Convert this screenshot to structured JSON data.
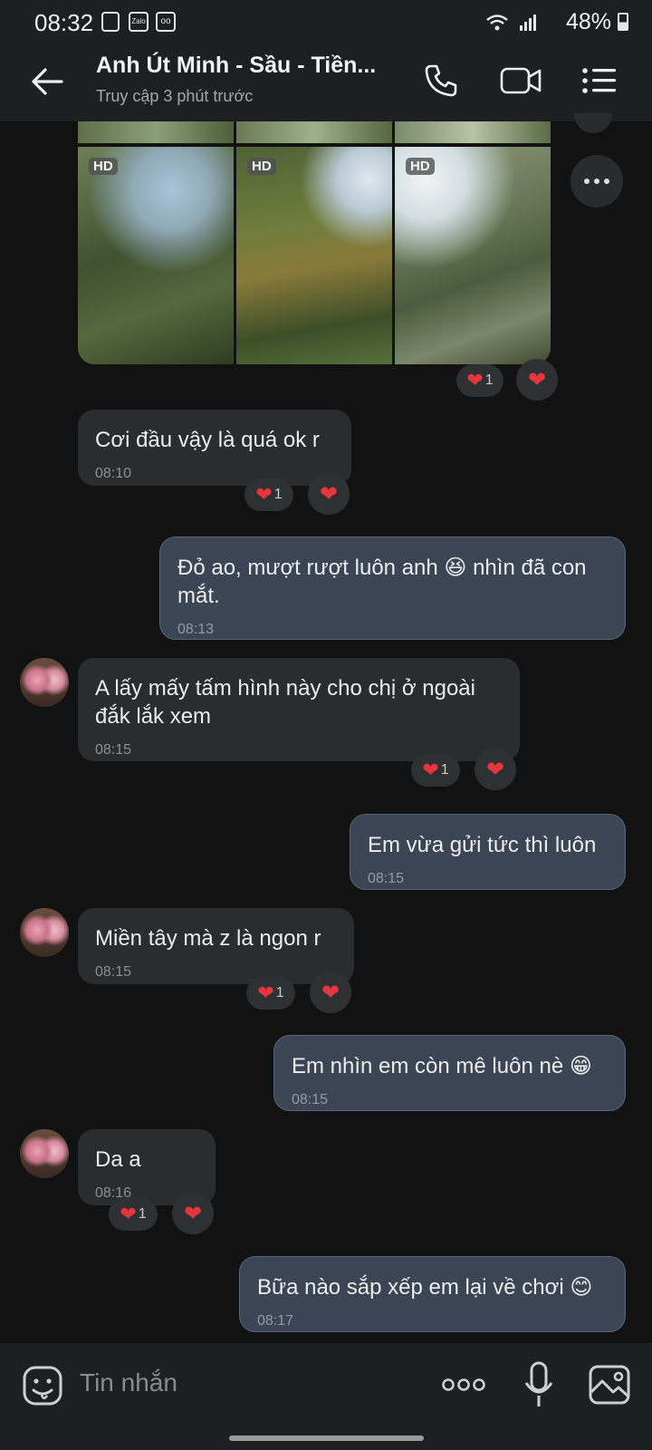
{
  "status": {
    "time": "08:32",
    "zalo": "Zalo",
    "battery": "48%"
  },
  "header": {
    "title": "Anh Út Minh - Sầu - Tiền...",
    "subtitle": "Truy cập 3 phút trước"
  },
  "photos": {
    "badge": "HD"
  },
  "messages": [
    {
      "text": "Cơi đầu vậy là quá ok r",
      "time": "08:10",
      "count": "1"
    },
    {
      "text": "Đỏ ao, mượt rượt luôn anh 😆 nhìn đã con mắt.",
      "time": "08:13"
    },
    {
      "text": "A lấy mấy tấm hình này cho chị ở ngoài đắk lắk xem",
      "time": "08:15",
      "count": "1"
    },
    {
      "text": "Em vừa gửi tức thì luôn",
      "time": "08:15"
    },
    {
      "text": "Miền tây mà z là ngon r",
      "time": "08:15",
      "count": "1"
    },
    {
      "text": "Em nhìn em còn mê luôn nè 😁",
      "time": "08:15"
    },
    {
      "text": "Da a",
      "time": "08:16",
      "count": "1"
    },
    {
      "text": "Bữa nào sắp xếp em lại về chơi 😊",
      "time": "08:17"
    }
  ],
  "photo_reaction_count": "1",
  "composer": {
    "placeholder": "Tin nhắn"
  }
}
